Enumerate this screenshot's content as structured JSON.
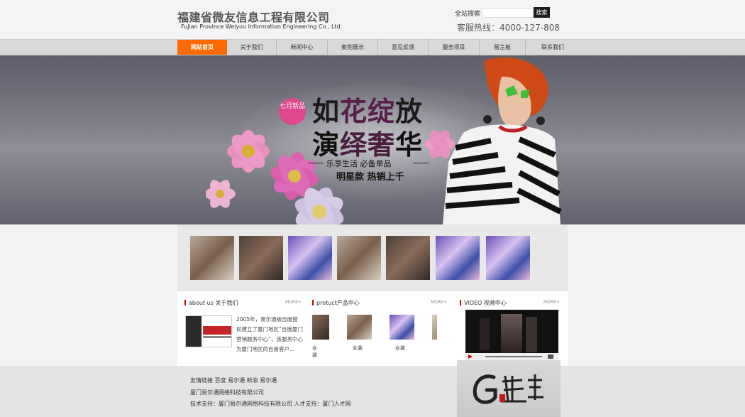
{
  "header": {
    "company_cn": "福建省微友信息工程有限公司",
    "company_en": "Fujian Province Weiyou Information Engineering Co., Ltd.",
    "search_label": "全站搜索",
    "search_placeholder": "",
    "search_button": "搜索",
    "hotline": "客服热线：4000-127-808"
  },
  "nav": {
    "items": [
      "网站首页",
      "关于我们",
      "新闻中心",
      "案例展示",
      "意见反馈",
      "服务项目",
      "留言板",
      "联系我们"
    ],
    "active_index": 0
  },
  "banner": {
    "badge": "七月新品",
    "title1_a": "如",
    "title1_b": "花绽",
    "title1_c": "放",
    "title2_a": "演",
    "title2_b": "绎奢",
    "title2_c": "华",
    "slogan": "乐享生活  必备单品",
    "sub": "明星款  热销上千"
  },
  "sections": {
    "about": {
      "title": "about us 关于我们",
      "more": "MORE+",
      "text": "2005年，易尔通被百度授权建立了厦门地区“百度厦门营销服务中心”，该服务中心为厦门地区的百度客户..."
    },
    "product": {
      "title": "protuct产品中心",
      "more": "MORE+",
      "labels": [
        "女装",
        "女装",
        "女装"
      ]
    },
    "video": {
      "title": "VIDEO 视频中心",
      "more": "MORE+"
    }
  },
  "footer": {
    "links": "友情链接 百度 易尔通 新浪 易尔通",
    "company": "厦门易尔通网络科技有限公司",
    "support": "技术支持：厦门易尔通网络科技有限公司 人才支持：厦门人才网"
  },
  "colors": {
    "accent": "#ff6a00",
    "badge": "#e0478f",
    "section_marker": "#cc0000"
  }
}
